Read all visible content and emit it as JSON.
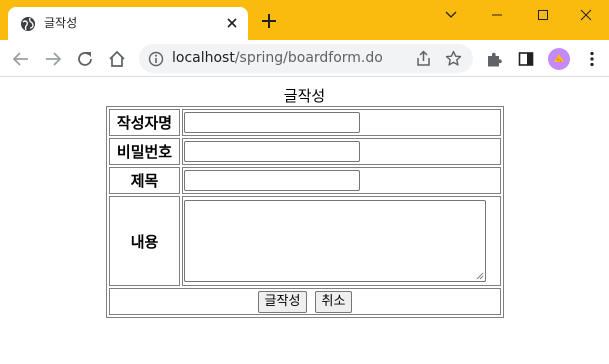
{
  "browser": {
    "tab_title": "글작성",
    "url_host": "localhost",
    "url_path": "/spring/boardform.do"
  },
  "page": {
    "title": "글작성",
    "rows": [
      {
        "label": "작성자명",
        "type": "text"
      },
      {
        "label": "비밀번호",
        "type": "text"
      },
      {
        "label": "제목",
        "type": "text"
      },
      {
        "label": "내용",
        "type": "textarea"
      }
    ],
    "buttons": {
      "submit_label": "글작성",
      "cancel_label": "취소"
    }
  },
  "icons": [
    "globe-icon",
    "close-icon",
    "plus-icon",
    "chevron-down-icon",
    "minimize-icon",
    "maximize-icon",
    "window-close-icon",
    "back-arrow-icon",
    "forward-arrow-icon",
    "reload-icon",
    "home-icon",
    "info-icon",
    "share-icon",
    "star-icon",
    "extensions-icon",
    "side-panel-icon",
    "menu-dots-icon"
  ],
  "colors": {
    "titlebar": "#fbbb0e",
    "omnibox": "#f1f3f4",
    "avatar": "#c58af9"
  }
}
